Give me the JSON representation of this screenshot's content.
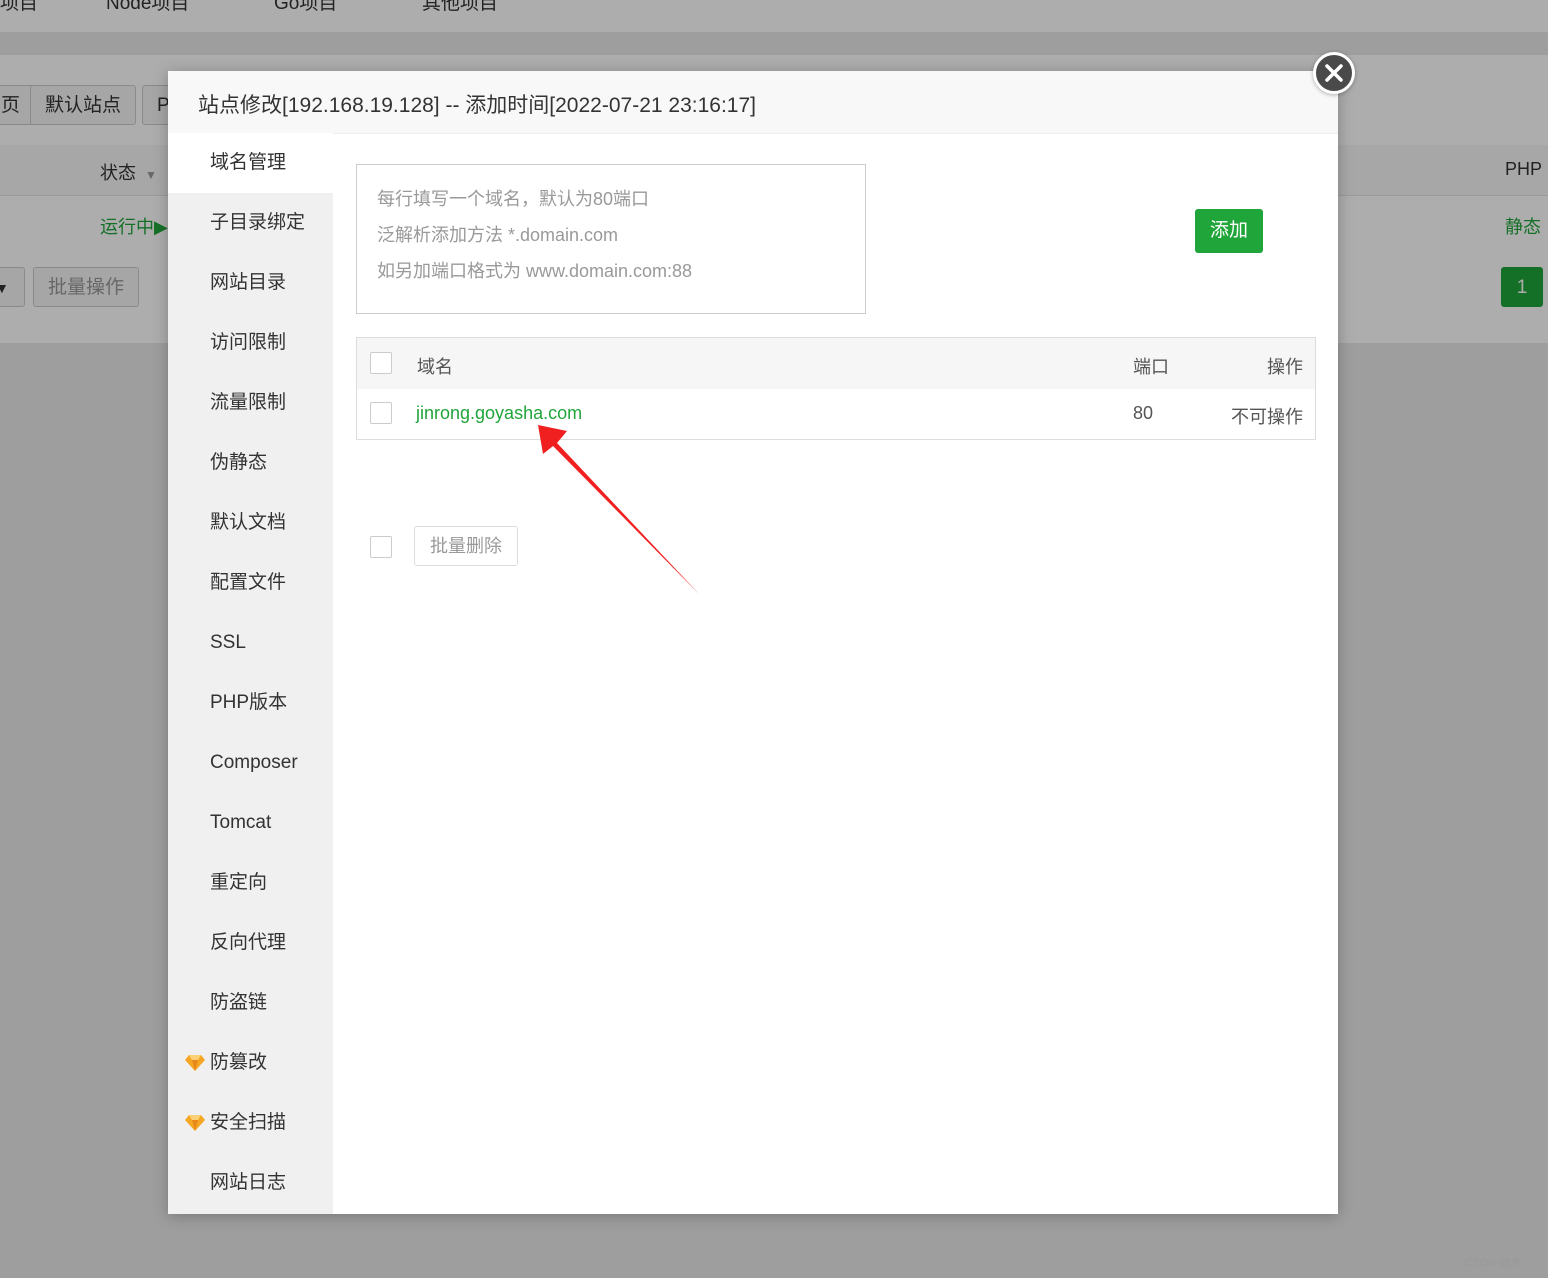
{
  "background": {
    "nav_tabs": [
      "项目",
      "Node项目",
      "Go项目",
      "其他项目"
    ],
    "toolbar": {
      "prev_partial": "页",
      "default_site": "默认站点",
      "p_partial": "P"
    },
    "table": {
      "status_header": "状态",
      "php_header": "PHP",
      "status_value": "运行中▶",
      "php_value": "静态"
    },
    "batch_ops": "批量操作",
    "page_number": "1"
  },
  "modal": {
    "title": "站点修改[192.168.19.128] -- 添加时间[2022-07-21 23:16:17]",
    "sidebar": [
      {
        "label": "域名管理",
        "active": true,
        "pro": false
      },
      {
        "label": "子目录绑定",
        "pro": false
      },
      {
        "label": "网站目录",
        "pro": false
      },
      {
        "label": "访问限制",
        "pro": false
      },
      {
        "label": "流量限制",
        "pro": false
      },
      {
        "label": "伪静态",
        "pro": false
      },
      {
        "label": "默认文档",
        "pro": false
      },
      {
        "label": "配置文件",
        "pro": false
      },
      {
        "label": "SSL",
        "pro": false
      },
      {
        "label": "PHP版本",
        "pro": false
      },
      {
        "label": "Composer",
        "pro": false
      },
      {
        "label": "Tomcat",
        "pro": false
      },
      {
        "label": "重定向",
        "pro": false
      },
      {
        "label": "反向代理",
        "pro": false
      },
      {
        "label": "防盗链",
        "pro": false
      },
      {
        "label": "防篡改",
        "pro": true
      },
      {
        "label": "安全扫描",
        "pro": true
      },
      {
        "label": "网站日志",
        "pro": false
      }
    ],
    "domain_input": {
      "placeholder_lines": [
        "每行填写一个域名，默认为80端口",
        "泛解析添加方法 *.domain.com",
        "如另加端口格式为 www.domain.com:88"
      ]
    },
    "add_label": "添加",
    "table": {
      "headers": {
        "domain": "域名",
        "port": "端口",
        "action": "操作"
      },
      "rows": [
        {
          "domain": "jinrong.goyasha.com",
          "port": "80",
          "action": "不可操作"
        }
      ]
    },
    "batch_delete": "批量删除"
  },
  "colors": {
    "accent_green": "#20a53a",
    "link_green": "#20a53a",
    "pro_gem": "#f5a623",
    "annotation_arrow": "#f02020"
  },
  "watermark": "CSDN @木···"
}
